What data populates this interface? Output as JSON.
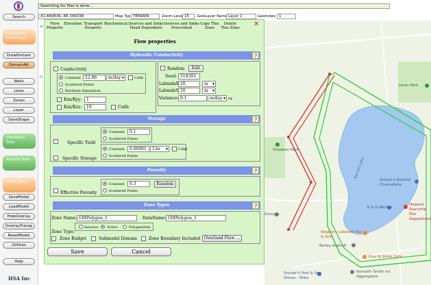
{
  "topbar": {
    "status": "Searching for files is done...",
    "coords": "41.840836,-88.349338",
    "map_type_label": "Map Type",
    "map_type": "TERRAIN",
    "zoom_label": "Zoom Level",
    "zoom": "15",
    "geolayer_label": "GeoLayer Name",
    "geolayer": "Layer 1",
    "geolayer_no_label": "GeoIndex",
    "geolayer_no": "1",
    "side_labels": [
      "al",
      "N"
    ]
  },
  "sidebar": {
    "search": "Search",
    "group_conceptual": "Conceptual Model Tools",
    "draw_domain": "DrawDomain",
    "domain_att": "DomainAtt",
    "wells": "Wells",
    "lines": "Lines",
    "zones": "Zones",
    "layer": "Layer",
    "saveshape": "SaveShape",
    "group_simulation": "Simulation Tools",
    "group_analysis": "Analysis Tools",
    "group_other": "Other Tools",
    "save_model": "SaveModel",
    "load_model": "LoadModel",
    "hide_overlay": "HideOverlay",
    "overlay_transp": "OverlayTransp",
    "reset_model": "ResetModel",
    "utilities": "Utilities",
    "help": "Help",
    "company": "HSA Inc"
  },
  "dialog": {
    "tabs": [
      "Flow Property",
      "Elevation",
      "Transport Property",
      "Biochemical",
      "Sources and Sinks Head Dependent",
      "Sources and Sinks Prescribed",
      "Copy This Zone",
      "Delete This Zone"
    ],
    "title": "Flow properties",
    "hydraulic": {
      "header": "Hydraulic Conductivity",
      "conductivity": "Conductivity",
      "constant": "Constant",
      "constant_value": "22.86",
      "unit": "m/day",
      "calib": "Calib",
      "scattered": "Scattered Points",
      "borehole": "Borehole Simulation",
      "kxx_kyy": "Kxx/Kyy:",
      "kxx_kyy_value": "1",
      "kxx_kzz": "Kxx/Kzz:",
      "kxx_kzz_value": "10",
      "calib2": "Calib",
      "random": "Random",
      "edit": "Edit",
      "seed_label": "Seed:",
      "seed": "318303",
      "lambdax_label": "LabmdaX:",
      "lambdax": "20",
      "lambday_label": "LabmdaY:",
      "lambday": "20",
      "unit_m": "m",
      "variance_label": "Variance:",
      "variance": "0.1",
      "variance_unit": "m/day",
      "sq": "sq"
    },
    "storage": {
      "header": "Storage",
      "specific_yield": "Specific Yield",
      "sy_constant": "Constant",
      "sy_value": "0.1",
      "sy_scattered": "Scattered Points",
      "specific_storage": "Specific Storage",
      "ss_constant": "Constant",
      "ss_value": "0.00001",
      "ss_unit": "1/m",
      "ss_calib": "Calib",
      "ss_scattered": "Scattered Points"
    },
    "porosity": {
      "header": "Porosity",
      "effective": "Effective Porosity",
      "constant": "Constant",
      "value": "0.3",
      "random": "Random",
      "scattered": "Scattered Points"
    },
    "zone_types": {
      "header": "Zone Types",
      "zone_name_label": "Zone Name:",
      "zone_name": "GMPolygon_1",
      "data_name_label": "DataName:",
      "data_name": "GMPolygon_1",
      "zone_type_label": "Zone Type:",
      "inactive": "Inactive",
      "active": "Active",
      "polygon_only": "PolygonOnly",
      "zone_budget": "Zone Budget",
      "submodel": "Submodel Domain",
      "boundary_included": "Zone Boundary Included",
      "overland_flow": "Overland Flow ..."
    },
    "save": "Save",
    "cancel": "Cancel",
    "help_glyph": "?",
    "close_glyph": "✕"
  },
  "map": {
    "labels": [
      "Jones Park",
      "Shodeen Park",
      "Barron Lake",
      "Archer's Almond Charcuterie",
      "K & G Marine",
      "Howard Township Fire Department",
      "Wagners Lakeside Bar & Grill",
      "Bailey Asphalt",
      "Rise N Shine Cafe",
      "Snyder's Pool & Spa Stores - Niles",
      "Kenneth Smith Inc Aggregates",
      "Group"
    ],
    "water_color": "#a4c8ef",
    "polygon_color": "#2fcf32",
    "line_color": "#e23030"
  }
}
